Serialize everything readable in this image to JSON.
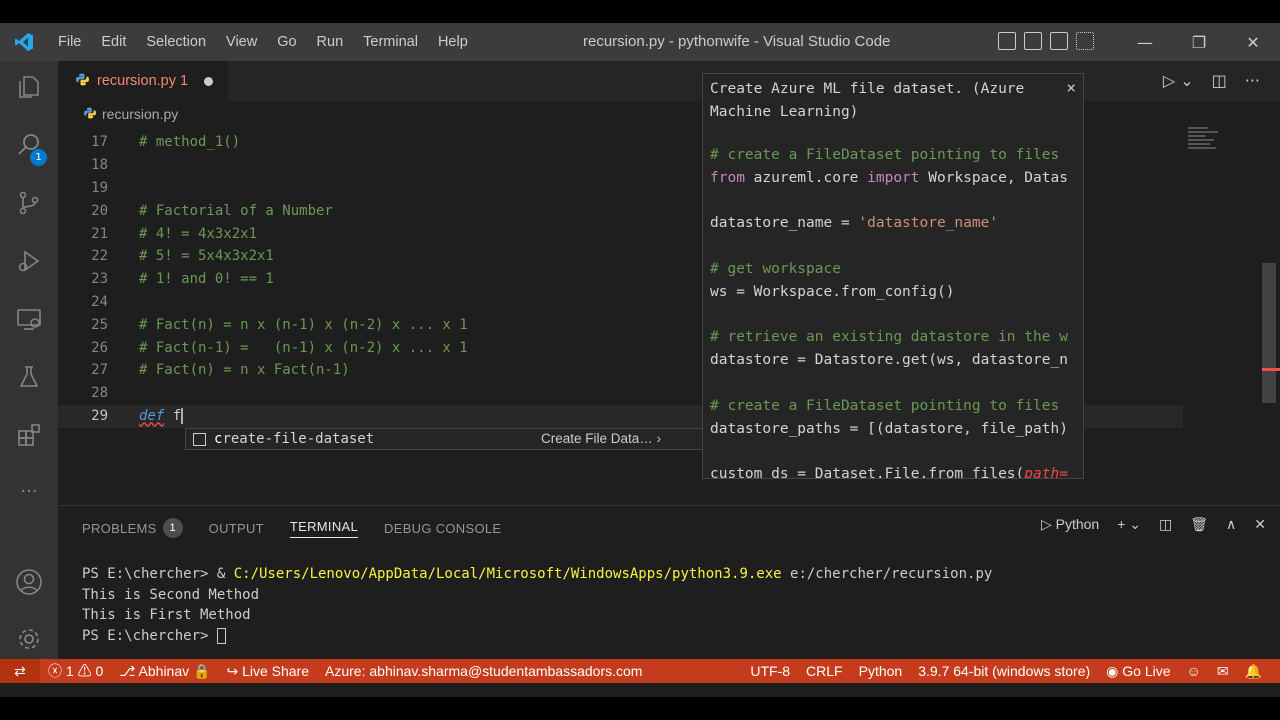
{
  "window": {
    "title": "recursion.py - pythonwife - Visual Studio Code"
  },
  "menu": [
    "File",
    "Edit",
    "Selection",
    "View",
    "Go",
    "Run",
    "Terminal",
    "Help"
  ],
  "activity": {
    "explorer_badge": "1"
  },
  "tab": {
    "label": "recursion.py 1"
  },
  "breadcrumb": {
    "file": "recursion.py"
  },
  "editor": {
    "lines": [
      {
        "num": "17",
        "text": "# method_1()",
        "type": "comment"
      },
      {
        "num": "18",
        "text": "",
        "type": "plain"
      },
      {
        "num": "19",
        "text": "",
        "type": "plain"
      },
      {
        "num": "20",
        "text": "# Factorial of a Number",
        "type": "comment"
      },
      {
        "num": "21",
        "text": "# 4! = 4x3x2x1",
        "type": "comment"
      },
      {
        "num": "22",
        "text": "# 5! = 5x4x3x2x1",
        "type": "comment"
      },
      {
        "num": "23",
        "text": "# 1! and 0! == 1",
        "type": "comment"
      },
      {
        "num": "24",
        "text": "",
        "type": "plain"
      },
      {
        "num": "25",
        "text": "# Fact(n) = n x (n-1) x (n-2) x ... x 1",
        "type": "comment"
      },
      {
        "num": "26",
        "text": "# Fact(n-1) =   (n-1) x (n-2) x ... x 1",
        "type": "comment"
      },
      {
        "num": "27",
        "text": "# Fact(n) = n x Fact(n-1)",
        "type": "comment"
      },
      {
        "num": "28",
        "text": "",
        "type": "plain"
      }
    ],
    "current_line": {
      "num": "29",
      "keyword": "def",
      "text": " f"
    }
  },
  "suggest": {
    "label_match": "c",
    "label_rest": "reate-file-dataset",
    "detail": "Create File Data…"
  },
  "doc": {
    "title": "Create Azure ML file dataset. (Azure Machine Learning)",
    "close": "×",
    "lines": [
      {
        "parts": [
          {
            "t": "# create a FileDataset pointing to files",
            "c": "d-cmt"
          }
        ]
      },
      {
        "parts": [
          {
            "t": "from",
            "c": "d-kw"
          },
          {
            "t": " azureml.core ",
            "c": ""
          },
          {
            "t": "import",
            "c": "d-kw"
          },
          {
            "t": " Workspace, Datas",
            "c": ""
          }
        ]
      },
      {
        "parts": []
      },
      {
        "parts": [
          {
            "t": "datastore_name = ",
            "c": ""
          },
          {
            "t": "'datastore_name'",
            "c": "d-str"
          }
        ]
      },
      {
        "parts": []
      },
      {
        "parts": [
          {
            "t": "# get workspace",
            "c": "d-cmt"
          }
        ]
      },
      {
        "parts": [
          {
            "t": "ws = Workspace.from_config()",
            "c": ""
          }
        ]
      },
      {
        "parts": []
      },
      {
        "parts": [
          {
            "t": "# retrieve an existing datastore in the w",
            "c": "d-cmt"
          }
        ]
      },
      {
        "parts": [
          {
            "t": "datastore = Datastore.get(ws, datastore_n",
            "c": ""
          }
        ]
      },
      {
        "parts": []
      },
      {
        "parts": [
          {
            "t": "# create a FileDataset pointing to files",
            "c": "d-cmt"
          }
        ]
      },
      {
        "parts": [
          {
            "t": "datastore_paths = [(datastore, file_path)",
            "c": ""
          }
        ]
      },
      {
        "parts": []
      },
      {
        "parts": [
          {
            "t": "custom_ds = Dataset.File.from_files(",
            "c": ""
          },
          {
            "t": "path=",
            "c": "d-par"
          }
        ]
      }
    ]
  },
  "panel": {
    "tabs": {
      "problems": "PROBLEMS",
      "problems_count": "1",
      "output": "OUTPUT",
      "terminal": "TERMINAL",
      "debug": "DEBUG CONSOLE"
    },
    "terminal_name": "Python",
    "terminal_lines": {
      "cmd_prefix": "PS E:\\chercher> & ",
      "cmd_path": "C:/Users/Lenovo/AppData/Local/Microsoft/WindowsApps/python3.9.exe",
      "cmd_arg": " e:/chercher/recursion.py",
      "out1": "This is Second Method",
      "out2": "This is First Method",
      "prompt": "PS E:\\chercher> "
    }
  },
  "statusbar": {
    "errors": "1",
    "warnings": "0",
    "user": "Abhinav",
    "live_share": "Live Share",
    "azure": "Azure: abhinav.sharma@studentambassadors.com",
    "encoding": "UTF-8",
    "eol": "CRLF",
    "language": "Python",
    "interpreter": "3.9.7 64-bit (windows store)",
    "go_live": "Go Live"
  },
  "colors": {
    "statusbar": "#c53c1c",
    "accent": "#007acc"
  }
}
